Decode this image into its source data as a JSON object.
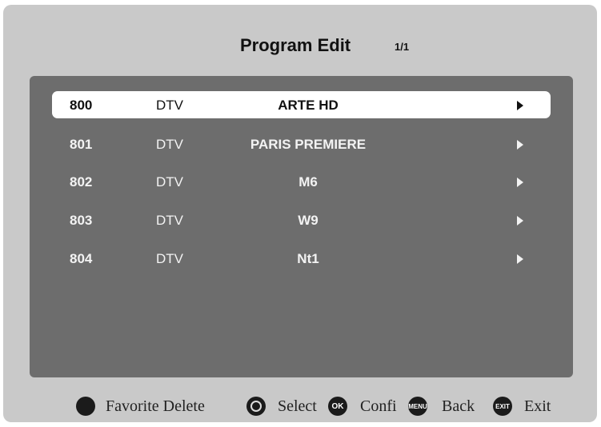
{
  "header": {
    "title": "Program Edit",
    "page": "1/1"
  },
  "channels": [
    {
      "number": "800",
      "type": "DTV",
      "name": "ARTE HD"
    },
    {
      "number": "801",
      "type": "DTV",
      "name": "PARIS PREMIERE"
    },
    {
      "number": "802",
      "type": "DTV",
      "name": "M6"
    },
    {
      "number": "803",
      "type": "DTV",
      "name": "W9"
    },
    {
      "number": "804",
      "type": "DTV",
      "name": "Nt1"
    }
  ],
  "selected_index": 0,
  "footer": {
    "favorite_delete": "Favorite Delete",
    "select": "Select",
    "ok_icon": "OK",
    "confirm": "Confi",
    "menu_icon": "MENU",
    "back": "Back",
    "exit_icon": "EXIT",
    "exit": "Exit"
  }
}
